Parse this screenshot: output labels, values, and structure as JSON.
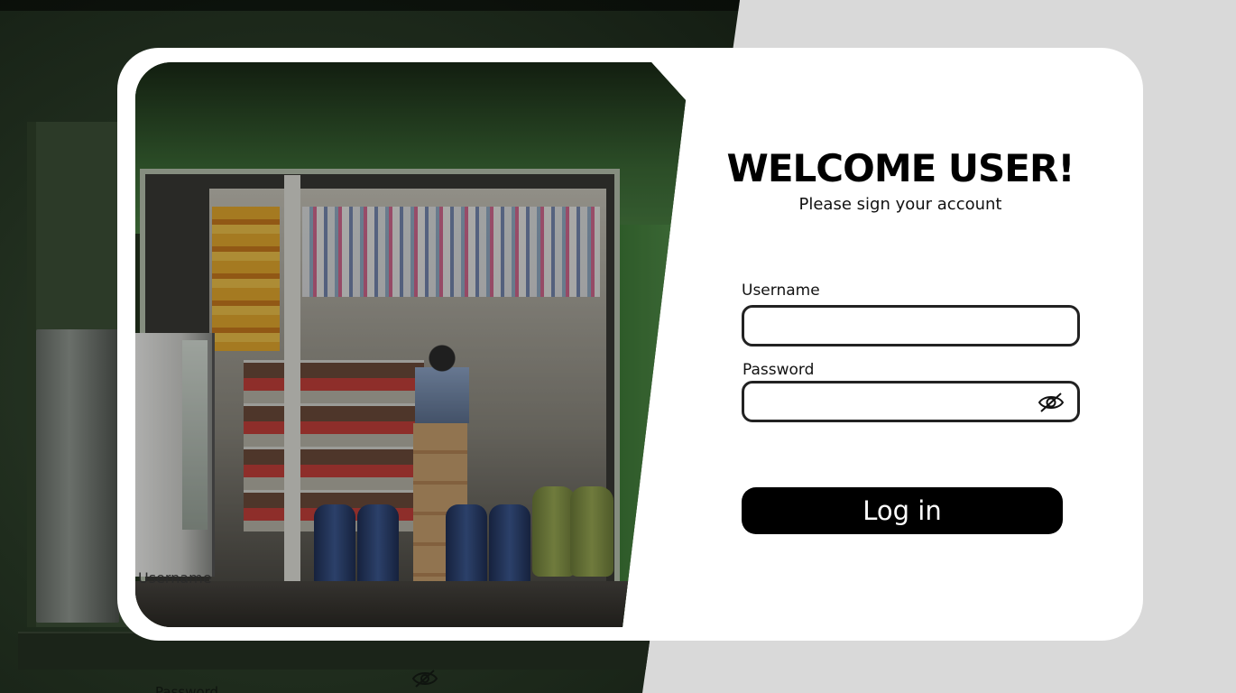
{
  "login": {
    "title": "WELCOME USER!",
    "subtitle": "Please sign your account",
    "username_label": "Username",
    "username_value": "",
    "password_label": "Password",
    "password_value": "",
    "login_label": "Log in"
  },
  "background": {
    "ghost_username_label": "Username",
    "ghost_password_label": "Password"
  },
  "icons": {
    "password_toggle": "eye-slash-icon"
  },
  "colors": {
    "page_background": "#d9d9d9",
    "card": "#ffffff",
    "button": "#000000",
    "button_text": "#ffffff"
  }
}
